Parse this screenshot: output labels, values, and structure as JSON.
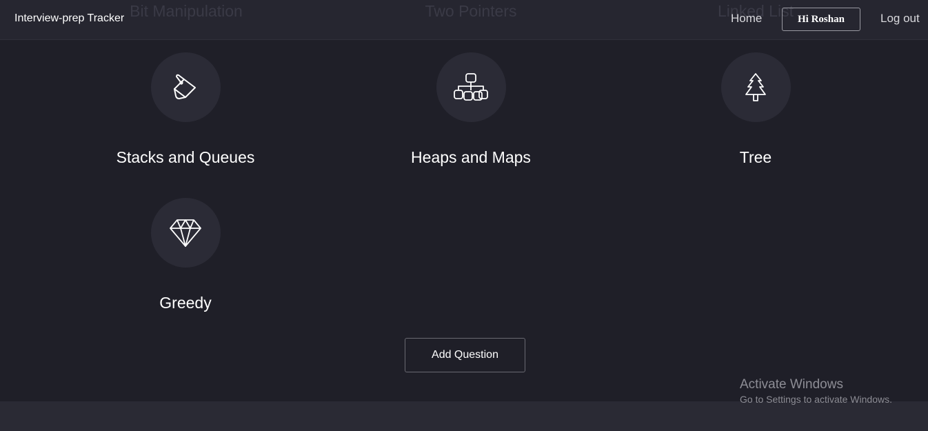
{
  "navbar": {
    "brand": "Interview-prep Tracker",
    "home": "Home",
    "user_greeting": "Hi Roshan",
    "logout": "Log out"
  },
  "faded_headings": [
    "Bit Manipulation",
    "Two Pointers",
    "Linked List"
  ],
  "topics": [
    {
      "label": "Stacks and Queues",
      "icon": "paint-bucket-icon"
    },
    {
      "label": "Heaps and Maps",
      "icon": "hierarchy-icon"
    },
    {
      "label": "Tree",
      "icon": "pine-tree-icon"
    },
    {
      "label": "Greedy",
      "icon": "diamond-icon"
    }
  ],
  "add_question": "Add Question",
  "watermark": {
    "title": "Activate Windows",
    "subtitle": "Go to Settings to activate Windows."
  },
  "colors": {
    "background": "#1f1f28",
    "navbar": "#262630",
    "icon_circle": "#2b2b36"
  }
}
